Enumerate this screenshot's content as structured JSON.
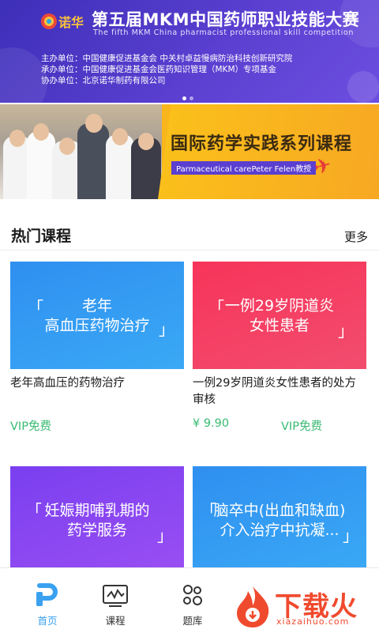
{
  "banner1": {
    "logo_text": "诺华",
    "title": "第五届MKM中国药师职业技能大赛",
    "subtitle": "The fifth MKM China pharmacist professional skill competition",
    "organizers": [
      "主办单位：中国健康促进基金会   中关村卓益慢病防治科技创新研究院",
      "承办单位：中国健康促进基金会医药知识管理（MKM）专项基金",
      "协办单位：北京诺华制药有限公司"
    ]
  },
  "banner2": {
    "title": "国际药学实践系列课程",
    "subtitle": "Parmaceutical carePeter Felen教授"
  },
  "section": {
    "title": "热门课程",
    "more": "更多"
  },
  "courses": [
    {
      "thumb_text": "老年\n高血压药物治疗",
      "title": "老年高血压的药物治疗",
      "price": "",
      "badge": "VIP免费"
    },
    {
      "thumb_text": "一例29岁阴道炎\n女性患者",
      "title": "一例29岁阴道炎女性患者的处方审核",
      "price": "¥ 9.90",
      "badge": "VIP免费"
    },
    {
      "thumb_text": "妊娠期哺乳期的\n药学服务",
      "title": "",
      "price": "",
      "badge": ""
    },
    {
      "thumb_text": "脑卒中(出血和缺血)\n介入治疗中抗凝...",
      "title": "",
      "price": "",
      "badge": ""
    }
  ],
  "tabbar": {
    "tabs": [
      {
        "label": "首页",
        "icon": "home-p-icon",
        "active": true
      },
      {
        "label": "课程",
        "icon": "course-monitor-icon",
        "active": false
      },
      {
        "label": "题库",
        "icon": "question-bank-icon",
        "active": false
      }
    ]
  },
  "watermark": {
    "text": "下载火",
    "url": "xiazaihuo.com"
  },
  "colors": {
    "accent": "#3aa1f0",
    "vip_green": "#3aba73",
    "banner_purple": "#4b36c4",
    "banner_orange": "#f9b51c"
  }
}
